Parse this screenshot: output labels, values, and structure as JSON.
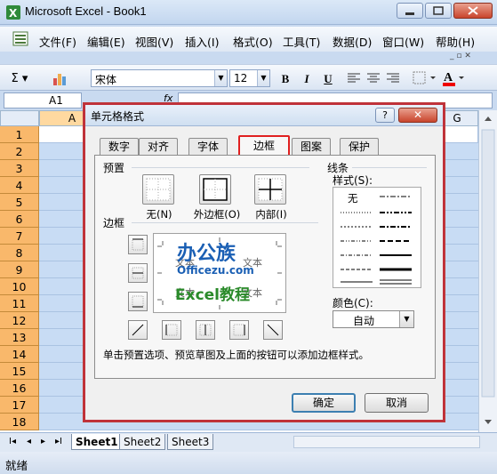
{
  "window": {
    "title": "Microsoft Excel - Book1"
  },
  "menu": {
    "items": [
      "文件(F)",
      "编辑(E)",
      "视图(V)",
      "插入(I)",
      "格式(O)",
      "工具(T)",
      "数据(D)",
      "窗口(W)",
      "帮助(H)"
    ],
    "controls": "_ ▫ ✕"
  },
  "toolbar": {
    "sum": "Σ",
    "font_name": "宋体",
    "font_size": "12",
    "bold": "B",
    "italic": "I",
    "underline": "U",
    "font_color_glyph": "A"
  },
  "formula_bar": {
    "name_box": "A1",
    "fx": "fx"
  },
  "grid": {
    "col_a": "A",
    "col_g": "G",
    "rows": [
      "1",
      "2",
      "3",
      "4",
      "5",
      "6",
      "7",
      "8",
      "9",
      "10",
      "11",
      "12",
      "13",
      "14",
      "15",
      "16",
      "17",
      "18"
    ]
  },
  "sheets": {
    "tabs": [
      "Sheet1",
      "Sheet2",
      "Sheet3"
    ],
    "nav": [
      "I◂",
      "◂",
      "▸",
      "▸I"
    ]
  },
  "status": {
    "text": "就绪"
  },
  "dialog": {
    "title": "单元格格式",
    "help": "?",
    "close": "✕",
    "tabs": [
      "数字",
      "对齐",
      "字体",
      "边框",
      "图案",
      "保护"
    ],
    "active_tab": "边框",
    "presets_label": "预置",
    "presets": [
      "无(N)",
      "外边框(O)",
      "内部(I)"
    ],
    "border_label": "边框",
    "line_label": "线条",
    "style_label": "样式(S):",
    "style_none": "无",
    "color_label": "颜色(C):",
    "color_value": "自动",
    "preview_text": [
      "文本",
      "文本",
      "文本",
      "文本"
    ],
    "watermark": {
      "line1": "办公族",
      "line2": "Officezu.com",
      "line3": "Excel教程"
    },
    "hint": "单击预置选项、预览草图及上面的按钮可以添加边框样式。",
    "ok": "确定",
    "cancel": "取消",
    "accent_color": "#e02020"
  }
}
